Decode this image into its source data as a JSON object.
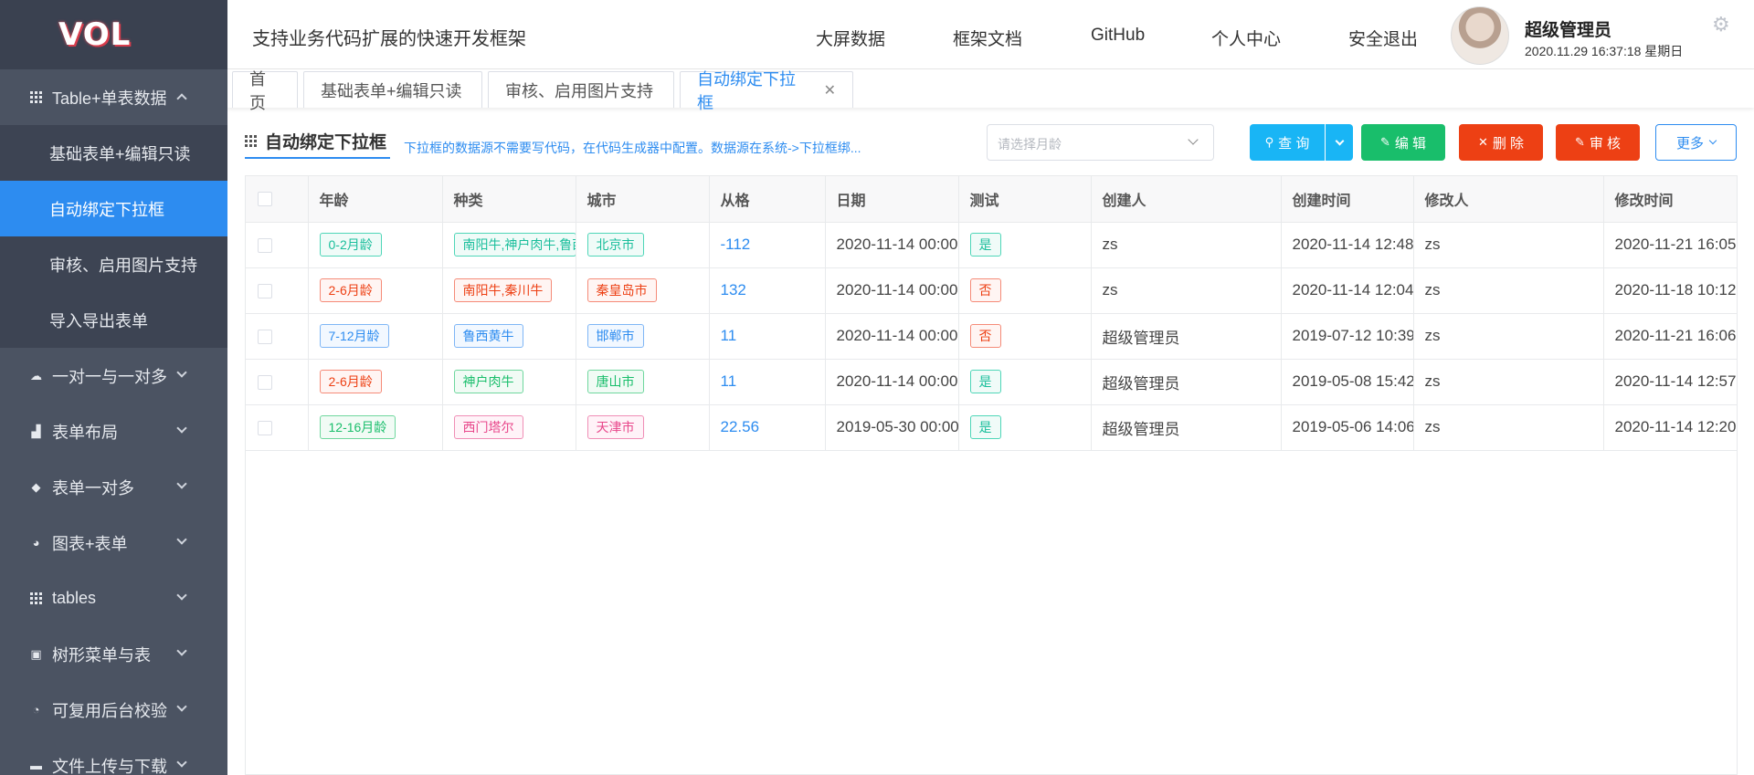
{
  "logo": "VOL",
  "sidebar": {
    "group": {
      "label": "Table+单表数据",
      "items": [
        "基础表单+编辑只读",
        "自动绑定下拉框",
        "审核、启用图片支持",
        "导入导出表单"
      ]
    },
    "menus": [
      {
        "label": "一对一与一对多",
        "icon": "cloud-icon"
      },
      {
        "label": "表单布局",
        "icon": "bar-chart-icon"
      },
      {
        "label": "表单一对多",
        "icon": "cube-icon"
      },
      {
        "label": "图表+表单",
        "icon": "pie-chart-icon"
      },
      {
        "label": "tables",
        "icon": "grid-icon"
      },
      {
        "label": "树形菜单与表",
        "icon": "line-chart-icon"
      },
      {
        "label": "可复用后台校验",
        "icon": "rss-icon"
      },
      {
        "label": "文件上传与下载",
        "icon": "folder-icon"
      }
    ]
  },
  "header": {
    "slogan": "支持业务代码扩展的快速开发框架",
    "nav": [
      "大屏数据",
      "框架文档",
      "GitHub",
      "个人中心",
      "安全退出"
    ],
    "user_name": "超级管理员",
    "user_time": "2020.11.29 16:37:18 星期日"
  },
  "tabs": [
    "首页",
    "基础表单+编辑只读",
    "审核、启用图片支持",
    "自动绑定下拉框"
  ],
  "toolbar": {
    "title": "自动绑定下拉框",
    "description": "下拉框的数据源不需要写代码，在代码生成器中配置。数据源在系统->下拉框绑...",
    "month_placeholder": "请选择月龄",
    "query": "查 询",
    "edit": "编 辑",
    "delete": "删 除",
    "audit": "审 核",
    "more": "更多"
  },
  "table": {
    "columns": [
      "年龄",
      "种类",
      "城市",
      "从格",
      "日期",
      "测试",
      "创建人",
      "创建时间",
      "修改人",
      "修改时间"
    ],
    "rows": [
      {
        "age": "0-2月龄",
        "age_color": "teal",
        "kind": "南阳牛,神户肉牛,鲁西黄牛",
        "kind_color": "teal",
        "city": "北京市",
        "city_color": "teal",
        "num": "-112",
        "date": "2020-11-14 00:00",
        "test": "是",
        "test_color": "teal",
        "creator": "zs",
        "created": "2020-11-14 12:48",
        "modifier": "zs",
        "modified": "2020-11-21 16:05"
      },
      {
        "age": "2-6月龄",
        "age_color": "red",
        "kind": "南阳牛,秦川牛",
        "kind_color": "red",
        "city": "秦皇岛市",
        "city_color": "red",
        "num": "132",
        "date": "2020-11-14 00:00",
        "test": "否",
        "test_color": "red",
        "creator": "zs",
        "created": "2020-11-14 12:04",
        "modifier": "zs",
        "modified": "2020-11-18 10:12"
      },
      {
        "age": "7-12月龄",
        "age_color": "blue",
        "kind": "鲁西黄牛",
        "kind_color": "blue",
        "city": "邯郸市",
        "city_color": "blue",
        "num": "11",
        "date": "2020-11-14 00:00",
        "test": "否",
        "test_color": "red",
        "creator": "超级管理员",
        "created": "2019-07-12 10:39",
        "modifier": "zs",
        "modified": "2020-11-21 16:06"
      },
      {
        "age": "2-6月龄",
        "age_color": "red",
        "kind": "神户肉牛",
        "kind_color": "green",
        "city": "唐山市",
        "city_color": "green",
        "num": "11",
        "date": "2020-11-14 00:00",
        "test": "是",
        "test_color": "teal",
        "creator": "超级管理员",
        "created": "2019-05-08 15:42",
        "modifier": "zs",
        "modified": "2020-11-14 12:57"
      },
      {
        "age": "12-16月龄",
        "age_color": "green",
        "kind": "西门塔尔",
        "kind_color": "pink",
        "city": "天津市",
        "city_color": "pink",
        "num": "22.56",
        "date": "2019-05-30 00:00",
        "test": "是",
        "test_color": "teal",
        "creator": "超级管理员",
        "created": "2019-05-06 14:06",
        "modifier": "zs",
        "modified": "2020-11-14 12:20"
      }
    ]
  }
}
